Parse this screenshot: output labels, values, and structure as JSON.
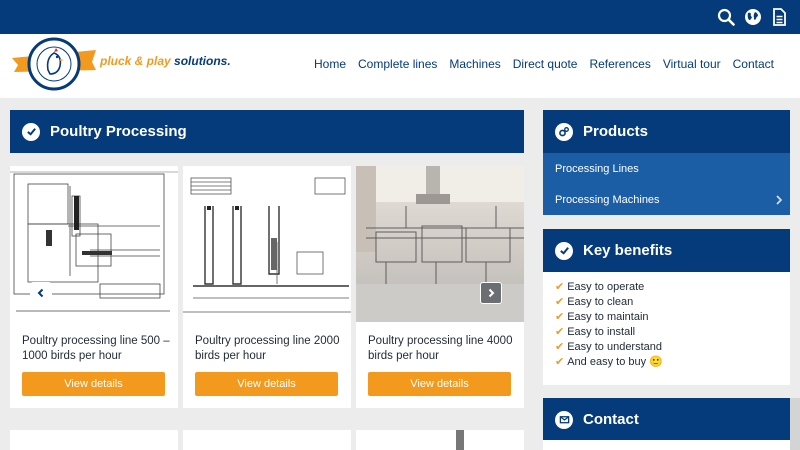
{
  "header": {
    "tagline_main": "pluck & play",
    "tagline_rest": " solutions.",
    "logo_text": "DUTCH POULTRY TECHNOLOGY",
    "top_icons": [
      "search-icon",
      "globe-icon",
      "document-icon"
    ]
  },
  "nav": [
    "Home",
    "Complete lines",
    "Machines",
    "Direct quote",
    "References",
    "Virtual tour",
    "Contact"
  ],
  "main": {
    "section_title": "Poultry Processing",
    "cards": [
      {
        "title": "Poultry processing line 500 – 1000 birds per hour",
        "button": "View details"
      },
      {
        "title": "Poultry processing line 2000 birds per hour",
        "button": "View details"
      },
      {
        "title": "Poultry processing line 4000 birds per hour",
        "button": "View details"
      }
    ]
  },
  "sidebar": {
    "products_title": "Products",
    "products_items": [
      "Processing Lines",
      "Processing Machines"
    ],
    "benefits_title": "Key benefits",
    "benefits": [
      "Easy to operate",
      "Easy to clean",
      "Easy to maintain",
      "Easy to install",
      "Easy to understand",
      "And easy to buy 🙂"
    ],
    "contact_title": "Contact"
  },
  "colors": {
    "primary": "#053b7a",
    "accent": "#f39a1e",
    "secondary": "#1c5ea6",
    "background": "#ececec"
  }
}
